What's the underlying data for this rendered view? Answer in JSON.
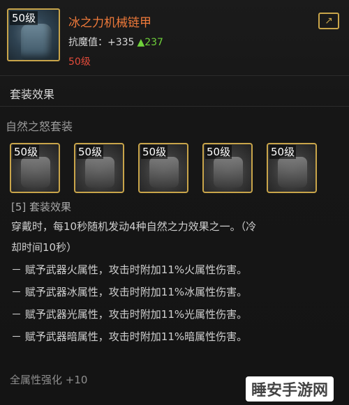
{
  "item": {
    "level_badge": "50级",
    "name": "冰之力机械链甲",
    "stat_label": "抗魔值：",
    "stat_value": "+335",
    "stat_up": "▲237",
    "required_level": "50级"
  },
  "set_section": {
    "title": "套装效果",
    "set_name": "自然之怒套装",
    "pieces": [
      {
        "level": "50级",
        "icon": "helmet-icon"
      },
      {
        "level": "50级",
        "icon": "chest-armor-icon"
      },
      {
        "level": "50级",
        "icon": "gauntlet-icon"
      },
      {
        "level": "50级",
        "icon": "belt-icon"
      },
      {
        "level": "50级",
        "icon": "boots-icon"
      }
    ],
    "bonus_header": "[5] 套装效果",
    "desc_lines": [
      "穿戴时，每10秒随机发动4种自然之力效果之一。（冷",
      "却时间10秒）",
      "－ 赋予武器火属性，攻击时附加11%火属性伤害。",
      "－ 赋予武器冰属性，攻击时附加11%冰属性伤害。",
      "－ 赋予武器光属性，攻击时附加11%光属性伤害。",
      "－ 赋予武器暗属性，攻击时附加11%暗属性伤害。"
    ],
    "bottom_stat": "全属性强化 +10"
  },
  "watermark": "睡安手游网",
  "colors": {
    "item_name": "#f07a3a",
    "stat_up": "#6fd13b",
    "required_level": "#e24b3a",
    "frame_gold": "#c9a54a"
  }
}
